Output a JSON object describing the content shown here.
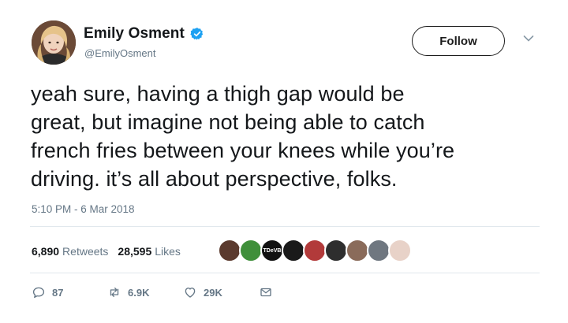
{
  "user": {
    "display_name": "Emily Osment",
    "handle": "@EmilyOsment",
    "verified": true
  },
  "follow_label": "Follow",
  "tweet": {
    "lines": [
      "yeah sure, having a thigh gap would be",
      "great, but imagine not being able to catch",
      "french fries between your knees while you’re",
      "driving. it’s all about perspective, folks."
    ],
    "timestamp": "5:10 PM - 6 Mar 2018"
  },
  "stats": {
    "retweets_count": "6,890",
    "retweets_label": "Retweets",
    "likes_count": "28,595",
    "likes_label": "Likes"
  },
  "liker_avatars": [
    {
      "color": "#5b3a2e"
    },
    {
      "color": "#3f8f3a"
    },
    {
      "color": "#111111",
      "text": "TDeVB"
    },
    {
      "color": "#1a1a1a"
    },
    {
      "color": "#b23a3a"
    },
    {
      "color": "#2e2e2e"
    },
    {
      "color": "#8a6b5a"
    },
    {
      "color": "#6f7780"
    },
    {
      "color": "#e8d2c8"
    }
  ],
  "actions": {
    "replies": "87",
    "retweets": "6.9K",
    "likes": "29K"
  },
  "colors": {
    "text": "#14171a",
    "secondary": "#657786",
    "verified_blue": "#1da1f2",
    "divider": "#e1e8ed"
  }
}
